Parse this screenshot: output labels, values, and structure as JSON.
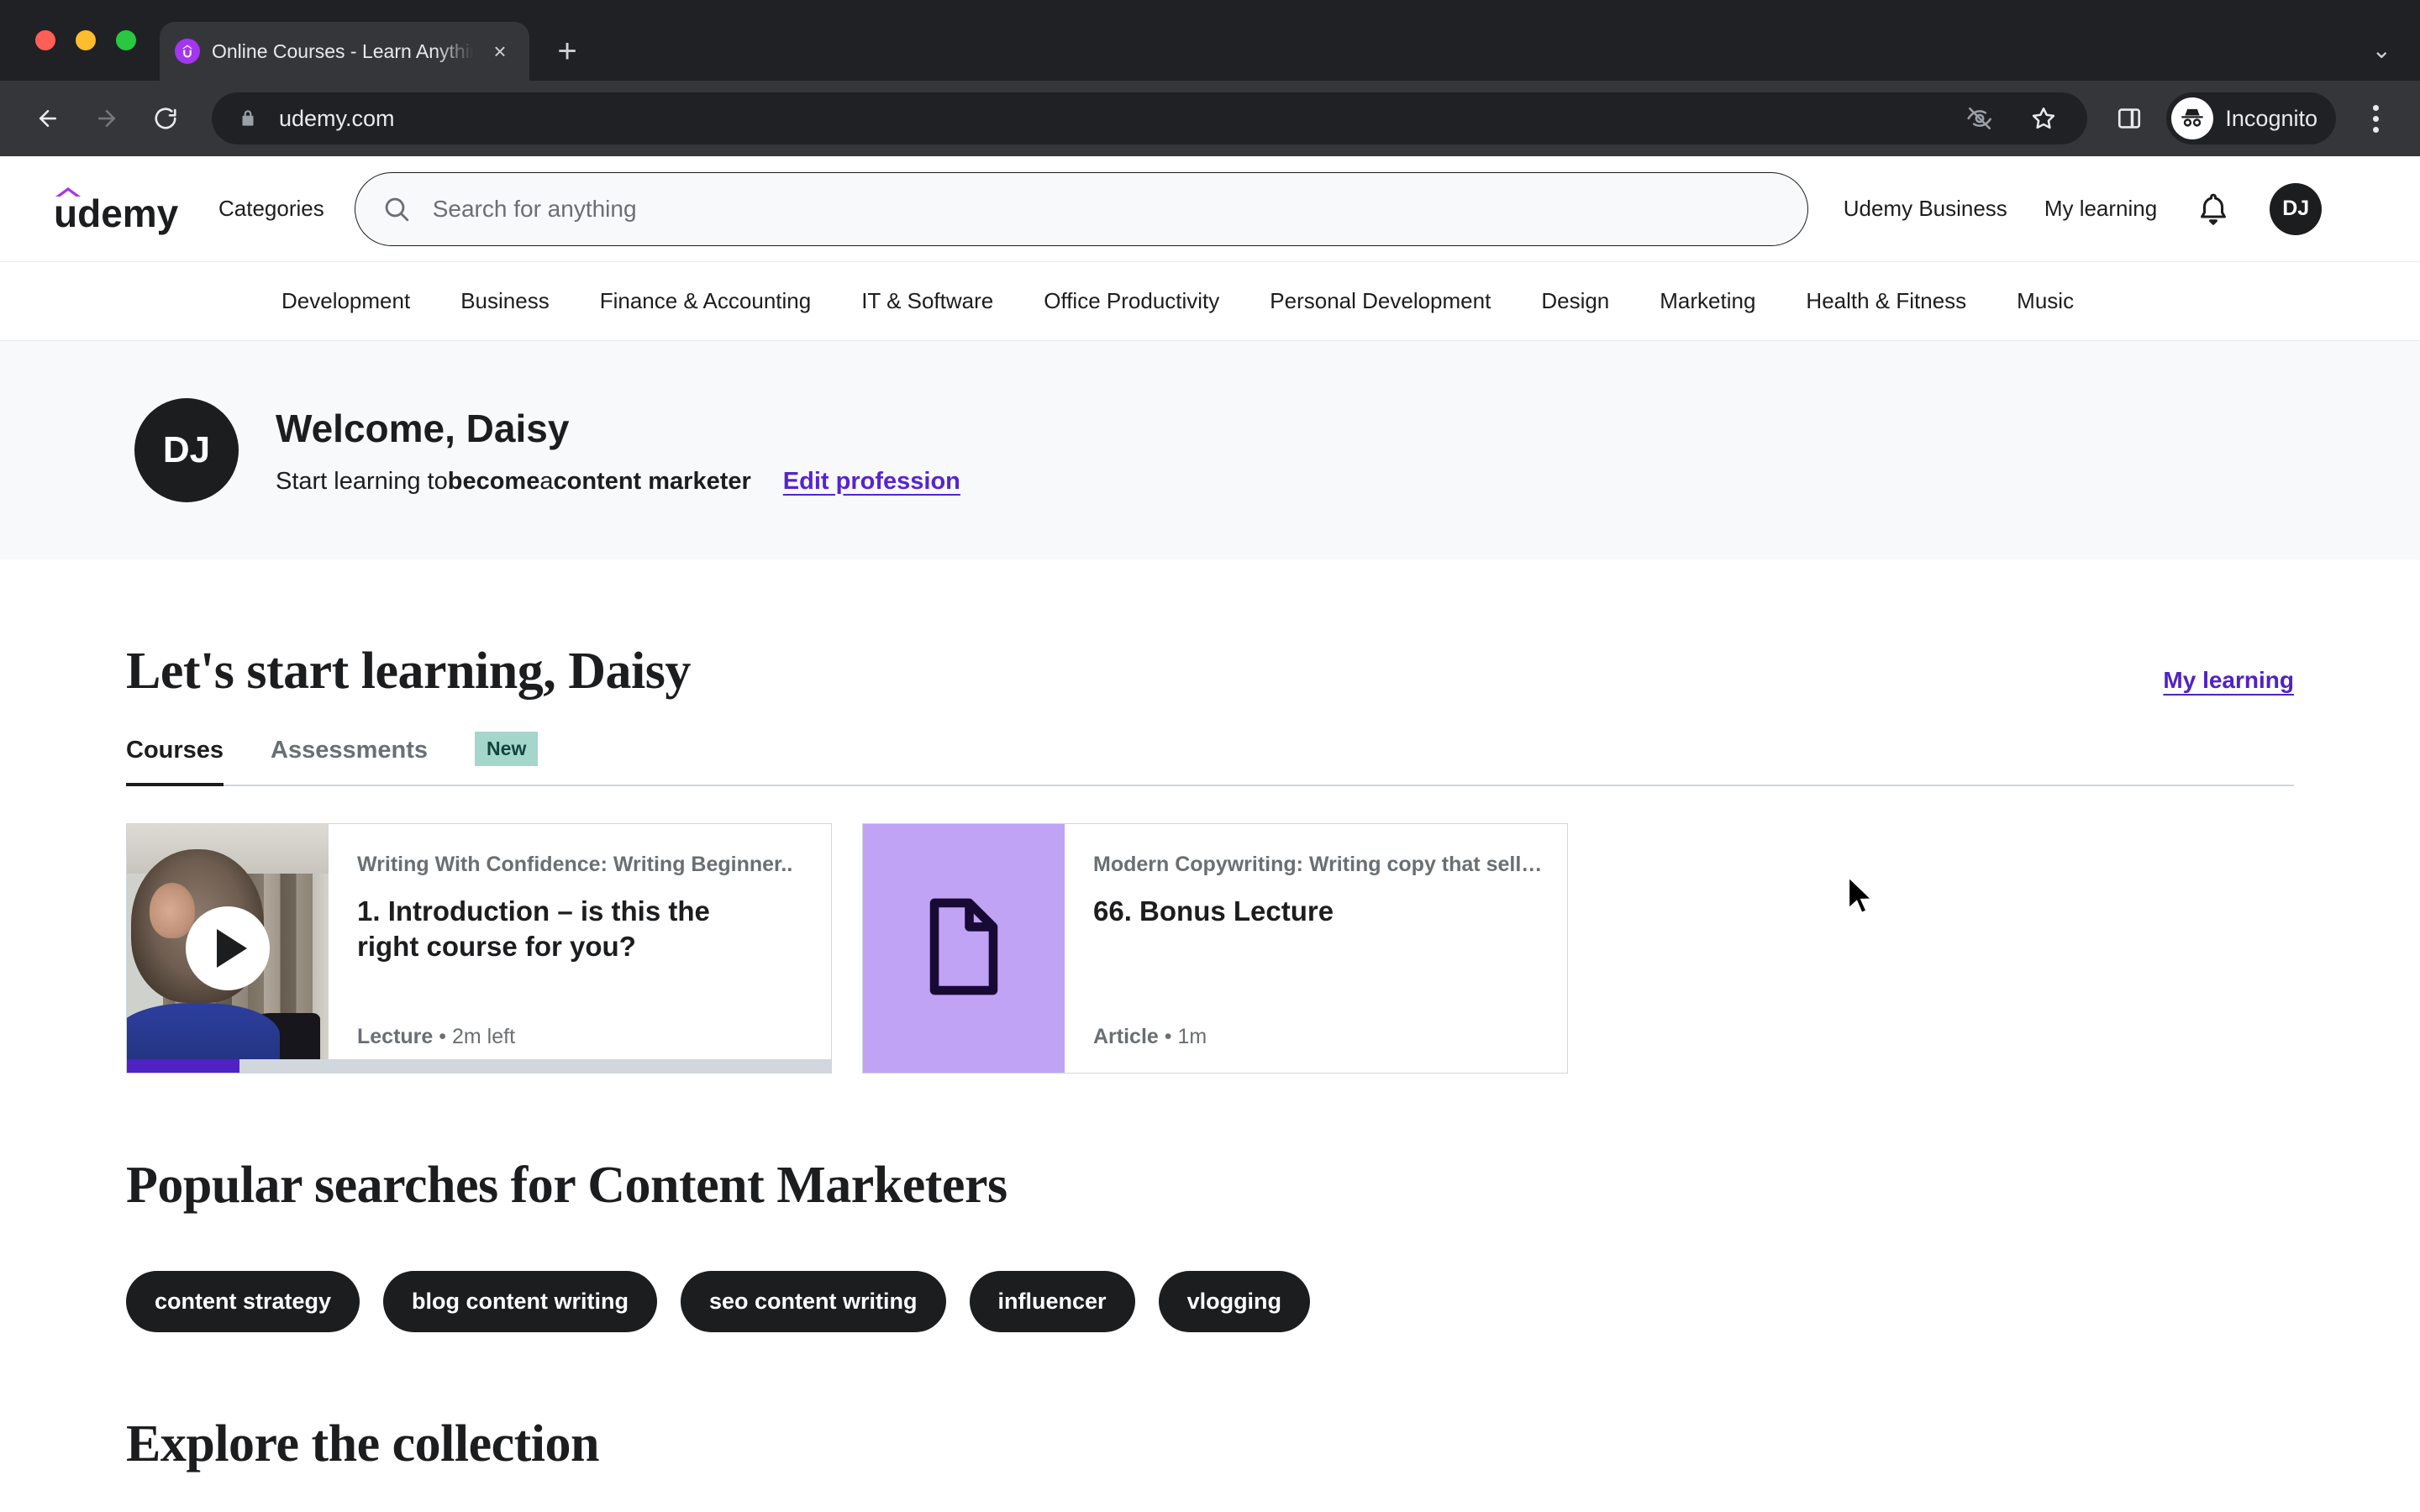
{
  "browser": {
    "tab": {
      "title": "Online Courses - Learn Anything, On Your Schedule",
      "favicon_letter": "û",
      "close_label": "×"
    },
    "new_tab_label": "+",
    "tabstrip_menu_label": "⌄",
    "url": "udemy.com",
    "profile_label": "Incognito",
    "back_label": "←",
    "forward_label": "→",
    "reload_label": "⟳"
  },
  "header": {
    "logo_text": "udemy",
    "categories_label": "Categories",
    "search_placeholder": "Search for anything",
    "search_value": "",
    "business_label": "Udemy Business",
    "my_learning_label": "My learning",
    "avatar_initials": "DJ"
  },
  "category_nav": {
    "items": [
      "Development",
      "Business",
      "Finance & Accounting",
      "IT & Software",
      "Office Productivity",
      "Personal Development",
      "Design",
      "Marketing",
      "Health & Fitness",
      "Music"
    ]
  },
  "welcome": {
    "avatar_initials": "DJ",
    "title": "Welcome, Daisy",
    "sub_prefix": "Start learning to ",
    "sub_bold_1": "become",
    "sub_mid": " a ",
    "sub_bold_2": "content marketer",
    "edit_link": "Edit profession"
  },
  "learning": {
    "heading": "Let's start learning, Daisy",
    "my_learning_link": "My learning",
    "tabs": [
      {
        "label": "Courses",
        "active": true
      },
      {
        "label": "Assessments",
        "active": false
      }
    ],
    "new_badge": "New",
    "cards": [
      {
        "course": "Writing With Confidence: Writing Beginner..",
        "title": "1. Introduction – is this the right course for you?",
        "type": "Lecture",
        "duration": "2m left",
        "separator": "•",
        "thumb_kind": "video",
        "progress_percent": 16
      },
      {
        "course": "Modern Copywriting: Writing copy that sell…",
        "title": "66. Bonus Lecture",
        "type": "Article",
        "duration": "1m",
        "separator": "•",
        "thumb_kind": "article",
        "progress_percent": 0
      }
    ]
  },
  "popular": {
    "heading": "Popular searches for Content Marketers",
    "pills": [
      "content strategy",
      "blog content writing",
      "seo content writing",
      "influencer",
      "vlogging"
    ]
  },
  "explore": {
    "heading": "Explore the collection"
  },
  "colors": {
    "brand_purple": "#a435f0",
    "link_purple": "#5624d0",
    "progress_purple": "#5022c3",
    "badge_teal": "#a5d6cb",
    "article_lavender": "#c0a3f5",
    "ink": "#1c1d1f"
  }
}
